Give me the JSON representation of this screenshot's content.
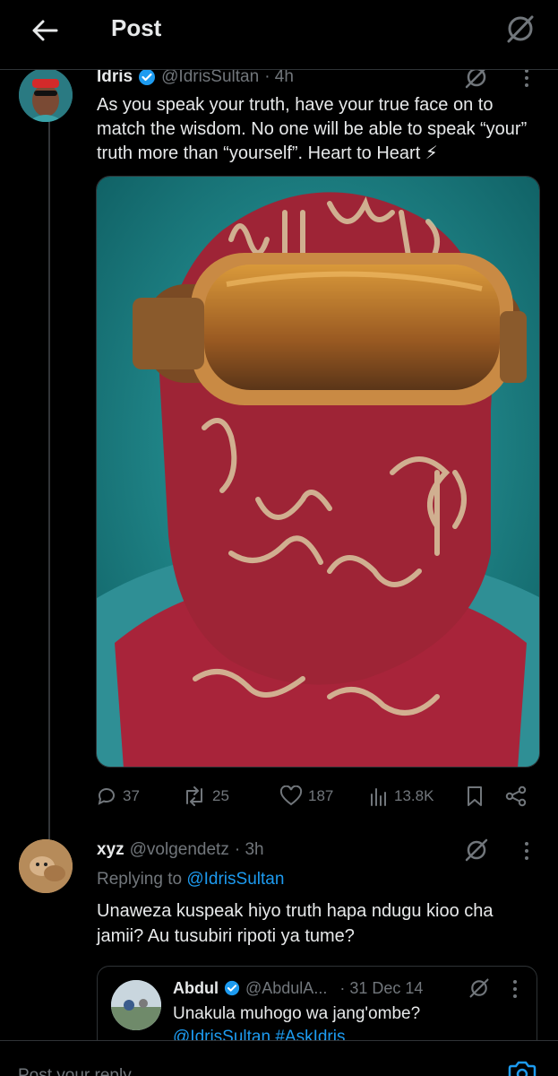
{
  "header": {
    "title": "Post"
  },
  "post": {
    "author_name": "Idris",
    "handle": "@IdrisSultan",
    "time": "· 4h",
    "text": "As you speak your truth, have your true face on to match the wisdom. No one will be able to speak “your” truth more than “yourself”. Heart to Heart ⚡",
    "stats": {
      "replies": "37",
      "reposts": "25",
      "likes": "187",
      "views": "13.8K"
    }
  },
  "reply": {
    "author_name": "xyz",
    "handle": "@volgendetz",
    "time": "· 3h",
    "replying_prefix": "Replying to",
    "replying_to": "@IdrisSultan",
    "text": "Unaweza kuspeak hiyo truth hapa ndugu kioo cha jamii? Au tusubiri ripoti ya tume?"
  },
  "quote": {
    "author_name": "Abdul",
    "handle": "@AbdulA...",
    "date": "· 31 Dec 14",
    "text": "Unakula muhogo wa jang'ombe?",
    "text2": "@IdrisSultan #AskIdris"
  },
  "composer": {
    "placeholder": "Post your reply"
  },
  "colors": {
    "accent": "#1d9bf0",
    "background": "#000000",
    "muted": "#71767b",
    "text": "#e7e9ea"
  },
  "icons": [
    "back-arrow-icon",
    "grok-icon",
    "verified-badge-icon",
    "reply-icon",
    "repost-icon",
    "like-icon",
    "views-icon",
    "bookmark-icon",
    "share-icon",
    "more-icon",
    "camera-icon"
  ]
}
